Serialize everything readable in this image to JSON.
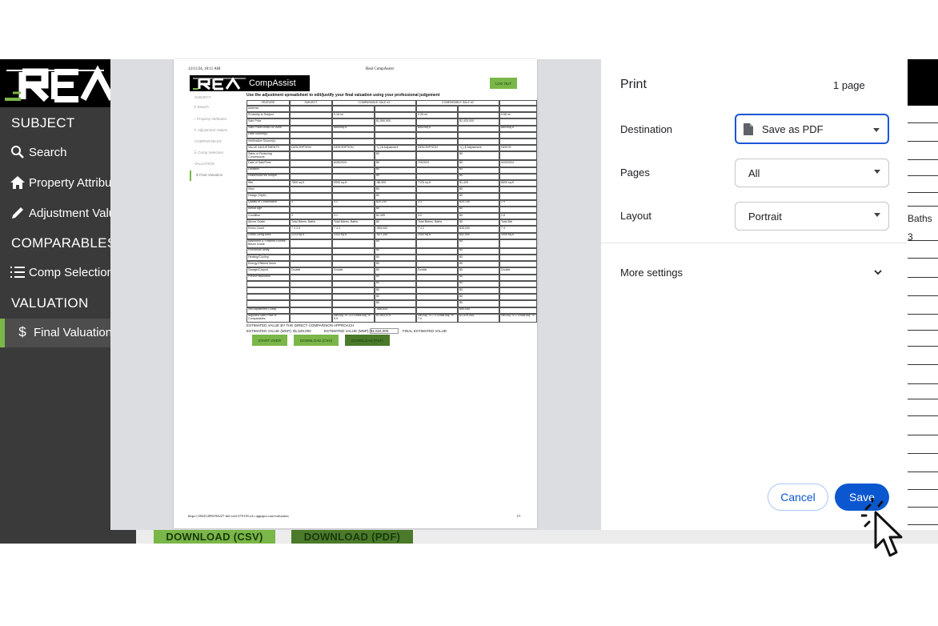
{
  "app": {
    "logo": "REAL",
    "sidebar": {
      "subject_head": "SUBJECT",
      "search": "Search",
      "property_attributes": "Property Attribu",
      "adjustment_values": "Adjustment Valu",
      "comparables_head": "COMPARABLES",
      "comp_selection": "Comp Selection",
      "valuation_head": "VALUATION",
      "final_valuation": "Final Valuation"
    },
    "bottom_buttons": {
      "csv": "DOWNLOAD (CSV)",
      "pdf": "DOWNLOAD (PDF)"
    },
    "right_fragment": {
      "baths": "Baths",
      "three": "3"
    },
    "colors": {
      "sidebar": "#3a3a3a",
      "accent_green": "#7ab648",
      "dark_green": "#4a7a2a"
    }
  },
  "print_dialog": {
    "title": "Print",
    "page_count": "1 page",
    "destination_label": "Destination",
    "destination_value": "Save as PDF",
    "pages_label": "Pages",
    "pages_value": "All",
    "layout_label": "Layout",
    "layout_value": "Portrait",
    "more_settings": "More settings",
    "cancel": "Cancel",
    "save": "Save",
    "colors": {
      "primary": "#0b57d0"
    }
  },
  "preview": {
    "header_date": "12/11/24, 10:11 AM",
    "header_title": "Real CompAssist",
    "brand": "CompAssist",
    "logout": "LOG OUT",
    "instruction": "Use the adjustment spreadsheet to edit/justify your final valuation using your professional judgement",
    "nav": {
      "subject": "SUBJECT",
      "search": "Search",
      "property_attributes": "Property Attributes",
      "adjustment_values": "Adjustment Values",
      "comparables": "COMPARABLES",
      "comp_selection": "Comp Selection",
      "valuation": "VALUATION",
      "final_valuation": "Final Valuation"
    },
    "table_header": [
      "FEATURE",
      "SUBJECT",
      "COMPARABLE SALE #1",
      "COMPARABLE SALE #2"
    ],
    "rows": [
      [
        "Address",
        "",
        "",
        "",
        "",
        ""
      ],
      [
        "Proximity to Subject",
        "",
        "0.16 mi",
        "",
        "0.28 mi",
        ""
      ],
      [
        "Sale Price",
        "",
        "",
        "$1,550,000",
        "",
        "$1,420,000"
      ],
      [
        "Sale Price/Gross Liv. Area",
        "",
        "$665/sq.ft.",
        "",
        "$652/sq.ft.",
        ""
      ],
      [
        "Data Source(s)",
        "",
        "",
        "",
        "",
        ""
      ],
      [
        "Verification Source(s)",
        "",
        "",
        "",
        "",
        ""
      ],
      [
        "VALUE ADJUSTMENTS",
        "DESCRIPTION",
        "DESCRIPTION",
        "+(-) $ Adjustment",
        "DESCRIPTION",
        "+(-) $ Adjustment"
      ],
      [
        "Sales or Financing Concessions",
        "",
        "",
        "$0",
        "",
        "$0"
      ],
      [
        "Date of Sale/Time",
        "",
        "6/26/2024",
        "$0",
        "7/9/2024",
        "$0"
      ],
      [
        "Location",
        "",
        "",
        "$0",
        "",
        "$0"
      ],
      [
        "Leasehold/Fee Simple",
        "",
        "",
        "$0",
        "",
        "$0"
      ],
      [
        "Site",
        "7600 sq.ft.",
        "9900 sq.ft.",
        "-$6,900",
        "7125 sq.ft.",
        "$1,425"
      ],
      [
        "View",
        "",
        "",
        "$0",
        "",
        "$0"
      ],
      [
        "Design (Style)",
        "",
        "",
        "$0",
        "",
        "$0"
      ],
      [
        "Quality of Construction",
        "3",
        "3.2",
        "$20,130",
        "3.3",
        "$20,130"
      ],
      [
        "Actual Age",
        "",
        "",
        "$0",
        "",
        "$0"
      ],
      [
        "Condition",
        "3",
        "3.1",
        "$2,495",
        "3.0",
        "$0"
      ],
      [
        "Above Grade",
        "Total Bdrms. Baths",
        "Total Bdrms. Baths",
        "$0",
        "Total Bdrms. Baths",
        "$0"
      ],
      [
        "Room Count",
        "7 4 2.5",
        "7 4 3",
        "-$35,000",
        "7 4 2",
        "$35,000"
      ],
      [
        "Gross Living Area",
        "2223 sq.ft.",
        "2332 sq.ft.",
        "-$27,250",
        "2053 sq.ft.",
        "$42,500"
      ],
      [
        "Basement & Finished Rooms Below Grade",
        "",
        "",
        "$0",
        "",
        "$0"
      ],
      [
        "Functional Utility",
        "",
        "",
        "$0",
        "",
        "$0"
      ],
      [
        "Heating/Cooling",
        "",
        "",
        "$0",
        "",
        "$0"
      ],
      [
        "Energy Efficient Items",
        "",
        "",
        "$0",
        "",
        "$0"
      ],
      [
        "Garage/Carport",
        "Double",
        "Double",
        "$0",
        "Double",
        "$0"
      ],
      [
        "Porch/Patio/Deck",
        "",
        "",
        "$0",
        "",
        "$0"
      ],
      [
        "",
        "",
        "",
        "$0",
        "",
        "$0"
      ],
      [
        "",
        "",
        "",
        "$0",
        "",
        "$0"
      ],
      [
        "",
        "",
        "",
        "$0",
        "",
        "$0"
      ],
      [
        "",
        "",
        "",
        "$0",
        "",
        "$0"
      ],
      [
        "Net Adjustment (Total)",
        "",
        "",
        "-$46,525",
        "",
        "$99,055"
      ],
      [
        "Adjusted Sale Price of Comparables",
        "",
        "Net Adj. % -3.0 Gross Adj. % 5.9",
        "$1,503,475",
        "Net Adj. % 7.0 Gross Adj. % 7.0",
        "$1,519,055"
      ]
    ],
    "extra_col": [
      "",
      "0.68 mi",
      "",
      "$804/sq.ft.",
      "",
      "",
      "DESCR",
      "",
      "9/20/2024",
      "",
      "",
      "6600 sq.ft",
      "",
      "",
      "2.9",
      "",
      "2.8",
      "Total Bdr",
      "7 4",
      "1909 sq.ft",
      "",
      "",
      "",
      "",
      "Double",
      "",
      "",
      "",
      "",
      "",
      "",
      "Net Adj. % 2 Gross Adj. %"
    ],
    "estimated_heading": "ESTIMATED VALUE BY THE DIRECT COMPARISON APPROACH",
    "est_mgp": "ESTIMATED VALUE (MGP): $1,529,000",
    "est_mnp": "ESTIMATED VALUE (MNP): $1,534,000",
    "final_est": "FINAL ESTIMATED VALUE:",
    "buttons": {
      "start_over": "START OVER",
      "csv": "DOWNLOAD (CSV)",
      "pdf": "DOWNLOAD (PDF)"
    },
    "footer_url": "https://20241209t194227-dot-real-270118.wl.r.appspot.com/valuation",
    "footer_page": "1/1"
  }
}
